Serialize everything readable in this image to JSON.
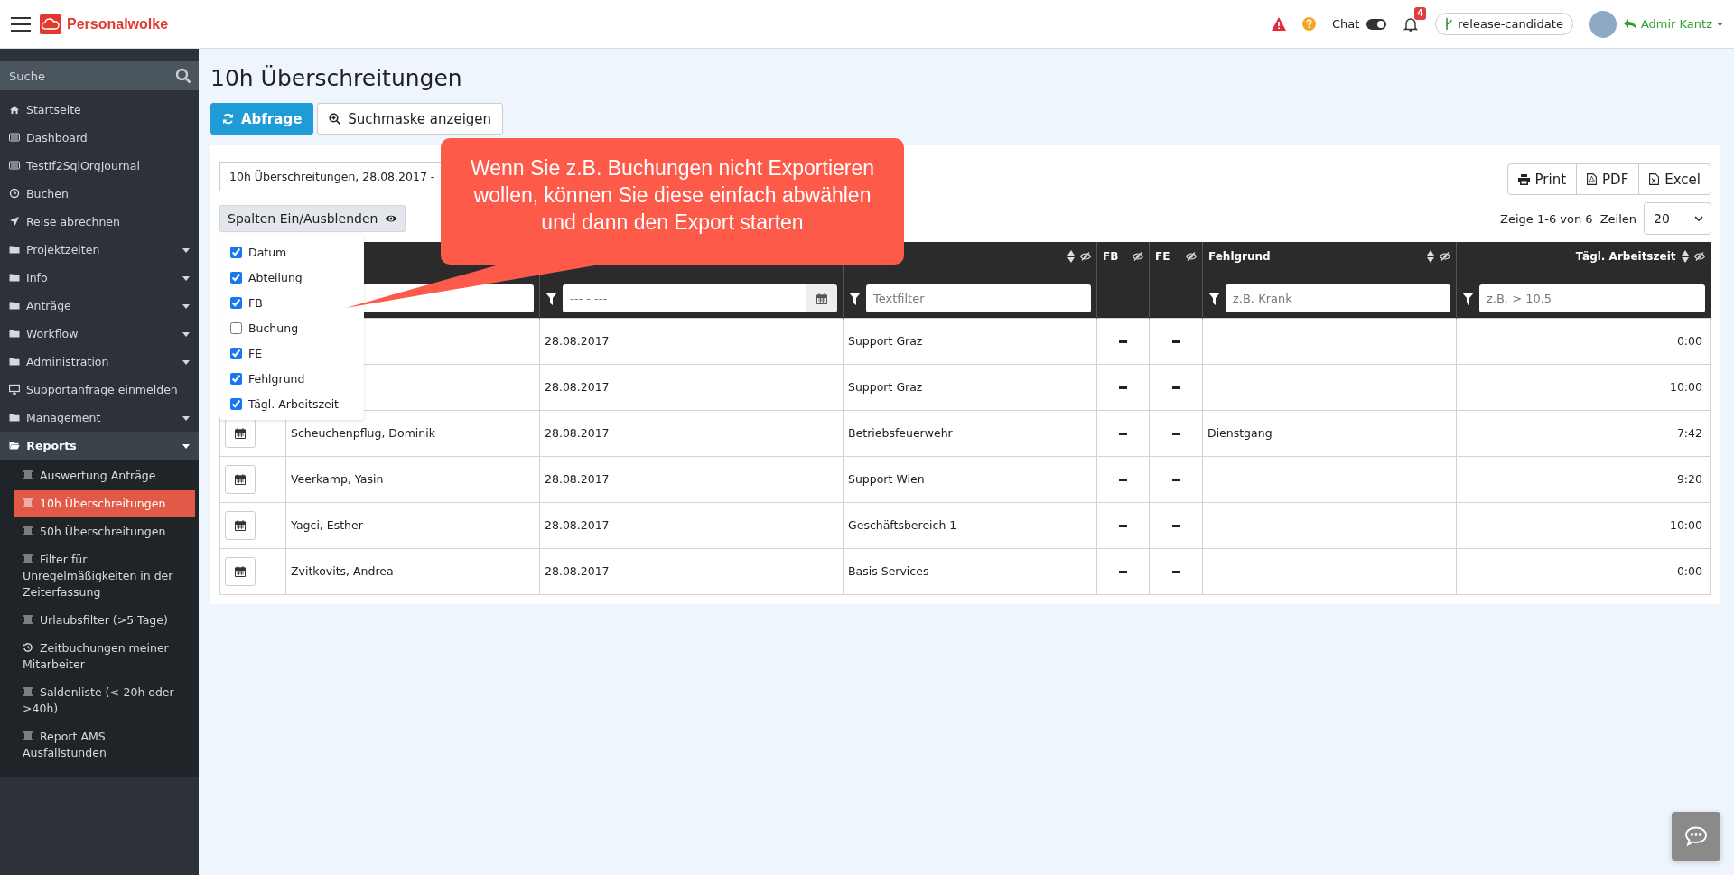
{
  "topbar": {
    "brand": "Personalwolke",
    "chat": {
      "label": "Chat",
      "on": true
    },
    "notifications": "4",
    "branch": "release-candidate",
    "user": "Admir Kantz"
  },
  "sidebar": {
    "search_placeholder": "Suche",
    "items": [
      {
        "label": "Startseite",
        "kind": "home",
        "selected": false
      },
      {
        "label": "Dashboard",
        "kind": "list",
        "selected": false
      },
      {
        "label": "TestIf2SqlOrgJournal",
        "kind": "list",
        "selected": false
      },
      {
        "label": "Buchen",
        "kind": "clock",
        "selected": false
      },
      {
        "label": "Reise abrechnen",
        "kind": "plane",
        "selected": false
      },
      {
        "label": "Projektzeiten",
        "kind": "folder",
        "expanded": false,
        "selected": false
      },
      {
        "label": "Info",
        "kind": "folder",
        "expanded": false,
        "selected": false
      },
      {
        "label": "Anträge",
        "kind": "folder",
        "expanded": false,
        "selected": false
      },
      {
        "label": "Workflow",
        "kind": "folder",
        "expanded": false,
        "selected": false
      },
      {
        "label": "Administration",
        "kind": "folder",
        "expanded": false,
        "selected": false
      },
      {
        "label": "Supportanfrage einmelden",
        "kind": "monitor",
        "selected": false
      },
      {
        "label": "Management",
        "kind": "folder",
        "expanded": false,
        "selected": false
      },
      {
        "label": "Reports",
        "kind": "folder",
        "expanded": true,
        "selected": false,
        "children": [
          {
            "label": "Auswertung Anträge",
            "kind": "list",
            "selected": false
          },
          {
            "label": "10h Überschreitungen",
            "kind": "list",
            "selected": true
          },
          {
            "label": "50h Überschreitungen",
            "kind": "list",
            "selected": false
          },
          {
            "label": "Filter für Unregelmäßigkeiten in der Zeiterfassung",
            "kind": "list",
            "selected": false
          },
          {
            "label": "Urlaubsfilter (>5 Tage)",
            "kind": "list",
            "selected": false
          },
          {
            "label": "Zeitbuchungen meiner Mitarbeiter",
            "kind": "history",
            "selected": false
          },
          {
            "label": "Saldenliste (<-20h oder >40h)",
            "kind": "list",
            "selected": false
          },
          {
            "label": "Report AMS Ausfallstunden",
            "kind": "list",
            "selected": false
          }
        ]
      }
    ]
  },
  "page": {
    "title": "10h Überschreitungen",
    "buttons": [
      {
        "label": "Abfrage",
        "kind": "primary"
      },
      {
        "label": "Suchmaske anzeigen",
        "kind": "search"
      }
    ],
    "report_field": "10h Überschreitungen, 28.08.2017 -",
    "columns_button": "Spalten Ein/Ausblenden",
    "column_menu": [
      {
        "label": "Datum",
        "checked": true
      },
      {
        "label": "Abteilung",
        "checked": true
      },
      {
        "label": "FB",
        "checked": true
      },
      {
        "label": "Buchung",
        "checked": false
      },
      {
        "label": "FE",
        "checked": true
      },
      {
        "label": "Fehlgrund",
        "checked": true
      },
      {
        "label": "Tägl. Arbeitszeit",
        "checked": true
      }
    ],
    "export_buttons": [
      {
        "label": "Print",
        "kind": "print"
      },
      {
        "label": "PDF",
        "kind": "pdf"
      },
      {
        "label": "Excel",
        "kind": "excel"
      }
    ],
    "paging": "Zeige 1-6 von 6",
    "rows_label": "Zeilen",
    "rows_value": "20",
    "callout": "Wenn Sie z.B. Buchungen nicht Exportieren wollen, können Sie diese einfach abwählen und dann den Export starten",
    "table": {
      "columns": [
        {
          "kind": "action"
        },
        {
          "kind": "text",
          "filter": {
            "kind": "text"
          }
        },
        {
          "kind": "text",
          "filter": {
            "kind": "daterange",
            "placeholder": "--- - ---"
          }
        },
        {
          "kind": "text",
          "sortable": true,
          "filter": {
            "kind": "text",
            "placeholder": "Textfilter"
          }
        },
        {
          "kind": "flag",
          "label": "FB"
        },
        {
          "kind": "flag",
          "label": "FE"
        },
        {
          "kind": "text",
          "label": "Fehlgrund",
          "sortable": true,
          "filter": {
            "kind": "text",
            "placeholder": "z.B. Krank"
          }
        },
        {
          "kind": "number",
          "label": "Tägl. Arbeitszeit",
          "sortable": true,
          "filter": {
            "kind": "text",
            "placeholder": "z.B. > 10.5"
          }
        }
      ],
      "rows": [
        {
          "date": "28.08.2017",
          "department": "Support Graz",
          "fb": false,
          "fe": false,
          "hours": "0:00"
        },
        {
          "date": "28.08.2017",
          "department": "Support Graz",
          "fb": false,
          "fe": false,
          "hours": "10:00"
        },
        {
          "name": "Scheuchenpflug, Dominik",
          "date": "28.08.2017",
          "department": "Betriebsfeuerwehr",
          "fb": false,
          "fe": false,
          "reason": "Dienstgang",
          "hours": "7:42"
        },
        {
          "name": "Veerkamp, Yasin",
          "date": "28.08.2017",
          "department": "Support Wien",
          "fb": false,
          "fe": false,
          "hours": "9:20"
        },
        {
          "name": "Yagci, Esther",
          "date": "28.08.2017",
          "department": "Geschäftsbereich 1",
          "fb": false,
          "fe": false,
          "hours": "10:00"
        },
        {
          "name": "Zvitkovits, Andrea",
          "date": "28.08.2017",
          "department": "Basis Services",
          "fb": false,
          "fe": false,
          "hours": "0:00"
        }
      ]
    }
  }
}
